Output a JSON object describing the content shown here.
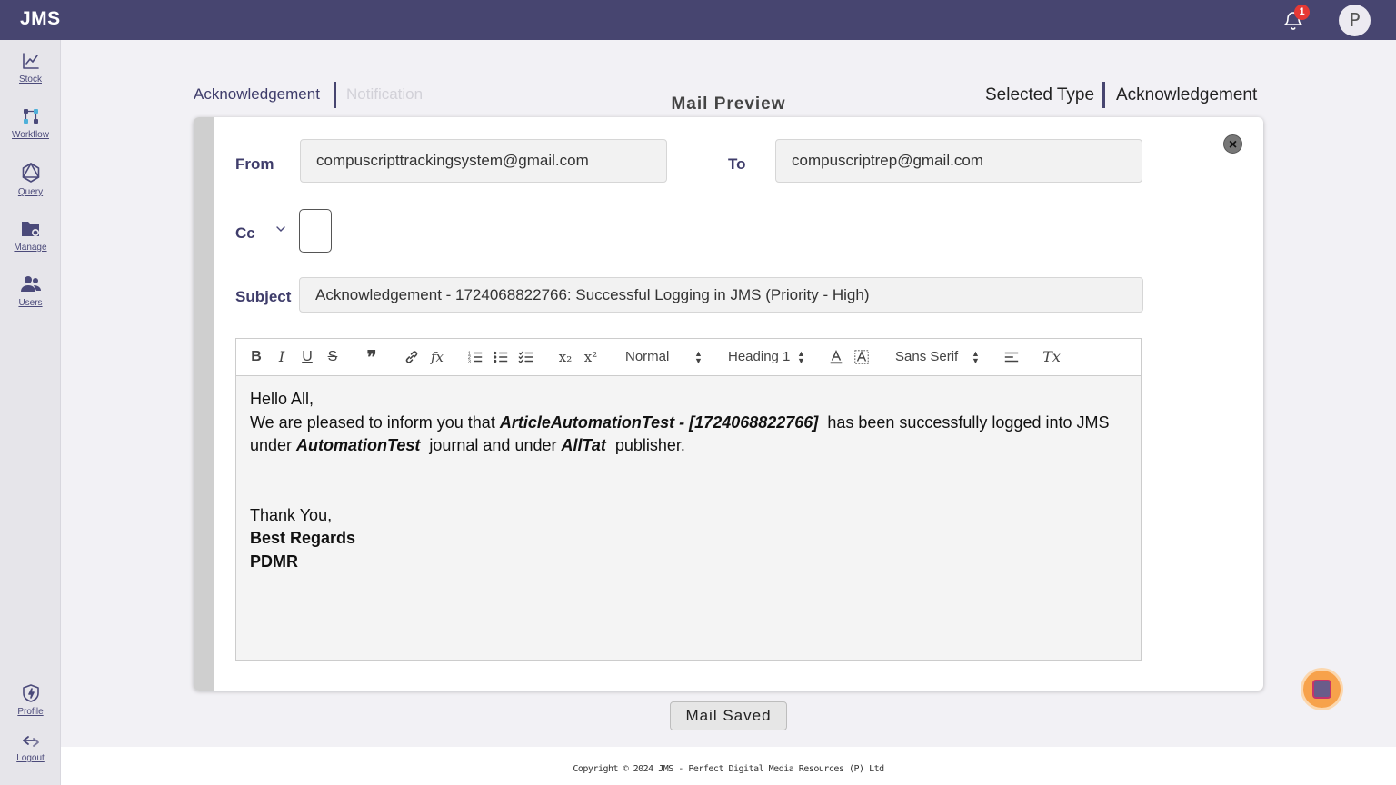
{
  "app": {
    "logo": "JMS"
  },
  "header": {
    "notification_count": "1",
    "avatar_initial": "P"
  },
  "sidebar": {
    "items": [
      {
        "label": "Stock",
        "icon": "chart-line-icon"
      },
      {
        "label": "Workflow",
        "icon": "workflow-icon"
      },
      {
        "label": "Query",
        "icon": "query-icon"
      },
      {
        "label": "Manage",
        "icon": "folder-gear-icon"
      },
      {
        "label": "Users",
        "icon": "users-icon"
      }
    ],
    "bottom": [
      {
        "label": "Profile",
        "icon": "profile-shield-icon"
      },
      {
        "label": "Logout",
        "icon": "logout-icon"
      }
    ]
  },
  "page": {
    "title": "Mail Preview",
    "tabs": [
      "Acknowledgement",
      "Notification"
    ],
    "selected_type_label": "Selected Type",
    "selected_type_value": "Acknowledgement"
  },
  "mail": {
    "from_label": "From",
    "from_value": "compuscripttrackingsystem@gmail.com",
    "to_label": "To",
    "to_value": "compuscriptrep@gmail.com",
    "cc_label": "Cc",
    "subject_label": "Subject",
    "subject_value": "Acknowledgement - 1724068822766: Successful Logging in JMS (Priority - High)"
  },
  "toolbar": {
    "bold": "B",
    "italic": "I",
    "underline": "U",
    "strike": "S",
    "quote": "❞",
    "formula": "fx",
    "subscript": "x₂",
    "superscript": "x²",
    "size_select": "Normal",
    "header_select": "Heading 1",
    "font_select": "Sans Serif",
    "clean": "Tx"
  },
  "body": {
    "greeting": "Hello All,",
    "line1_a": "We are pleased to inform you that ",
    "article": "ArticleAutomationTest - [1724068822766]",
    "line1_b": "  has been successfully logged into JMS",
    "line2_a": "under ",
    "journal": "AutomationTest",
    "line2_b": "  journal and under ",
    "publisher": "AllTat",
    "line2_c": "  publisher.",
    "thanks": "Thank You,",
    "regards": "Best Regards",
    "signature": "PDMR"
  },
  "actions": {
    "mail_saved": "Mail Saved"
  },
  "footer": {
    "copyright": "Copyright © 2024 JMS - Perfect Digital Media Resources (P) Ltd"
  },
  "colors": {
    "primary": "#474570",
    "badge": "#e53935",
    "fab": "#f7a24b"
  }
}
